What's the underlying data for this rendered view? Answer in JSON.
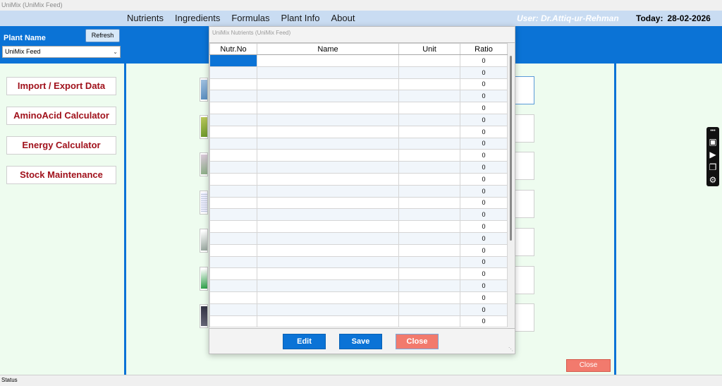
{
  "window": {
    "title": "UniMix (UniMix Feed)"
  },
  "menu": {
    "items": [
      "Nutrients",
      "Ingredients",
      "Formulas",
      "Plant Info",
      "About"
    ]
  },
  "header": {
    "user": "User: Dr.Attiq-ur-Rehman",
    "today_label": "Today:",
    "today_value": "28-02-2026"
  },
  "plant": {
    "label": "Plant Name",
    "refresh_label": "Refresh",
    "selected": "UniMix Feed"
  },
  "sidebar": {
    "buttons": [
      "Import / Export Data",
      "AminoAcid Calculator",
      "Energy Calculator",
      "Stock Maintenance"
    ]
  },
  "main": {
    "close_label": "Close"
  },
  "status": {
    "text": "Status"
  },
  "dialog": {
    "title": "UniMix  Nutrients (UniMix Feed)",
    "columns": [
      "Nutr.No",
      "Name",
      "Unit",
      "Ratio"
    ],
    "rows": [
      {
        "nutr": "",
        "name": "",
        "unit": "",
        "ratio": "0"
      },
      {
        "nutr": "",
        "name": "",
        "unit": "",
        "ratio": "0"
      },
      {
        "nutr": "",
        "name": "",
        "unit": "",
        "ratio": "0"
      },
      {
        "nutr": "",
        "name": "",
        "unit": "",
        "ratio": "0"
      },
      {
        "nutr": "",
        "name": "",
        "unit": "",
        "ratio": "0"
      },
      {
        "nutr": "",
        "name": "",
        "unit": "",
        "ratio": "0"
      },
      {
        "nutr": "",
        "name": "",
        "unit": "",
        "ratio": "0"
      },
      {
        "nutr": "",
        "name": "",
        "unit": "",
        "ratio": "0"
      },
      {
        "nutr": "",
        "name": "",
        "unit": "",
        "ratio": "0"
      },
      {
        "nutr": "",
        "name": "",
        "unit": "",
        "ratio": "0"
      },
      {
        "nutr": "",
        "name": "",
        "unit": "",
        "ratio": "0"
      },
      {
        "nutr": "",
        "name": "",
        "unit": "",
        "ratio": "0"
      },
      {
        "nutr": "",
        "name": "",
        "unit": "",
        "ratio": "0"
      },
      {
        "nutr": "",
        "name": "",
        "unit": "",
        "ratio": "0"
      },
      {
        "nutr": "",
        "name": "",
        "unit": "",
        "ratio": "0"
      },
      {
        "nutr": "",
        "name": "",
        "unit": "",
        "ratio": "0"
      },
      {
        "nutr": "",
        "name": "",
        "unit": "",
        "ratio": "0"
      },
      {
        "nutr": "",
        "name": "",
        "unit": "",
        "ratio": "0"
      },
      {
        "nutr": "",
        "name": "",
        "unit": "",
        "ratio": "0"
      },
      {
        "nutr": "",
        "name": "",
        "unit": "",
        "ratio": "0"
      },
      {
        "nutr": "",
        "name": "",
        "unit": "",
        "ratio": "0"
      },
      {
        "nutr": "",
        "name": "",
        "unit": "",
        "ratio": "0"
      },
      {
        "nutr": "",
        "name": "",
        "unit": "",
        "ratio": "0"
      }
    ],
    "edit_label": "Edit",
    "save_label": "Save",
    "close_label": "Close"
  },
  "icons": {
    "tools": [
      "more-icon",
      "camera-icon",
      "video-icon",
      "windows-icon",
      "gear-icon"
    ]
  },
  "colors": {
    "primary": "#0b73d6",
    "danger": "#f27a6d",
    "panel_bg": "#eefcef",
    "title_text": "#a0111b"
  }
}
